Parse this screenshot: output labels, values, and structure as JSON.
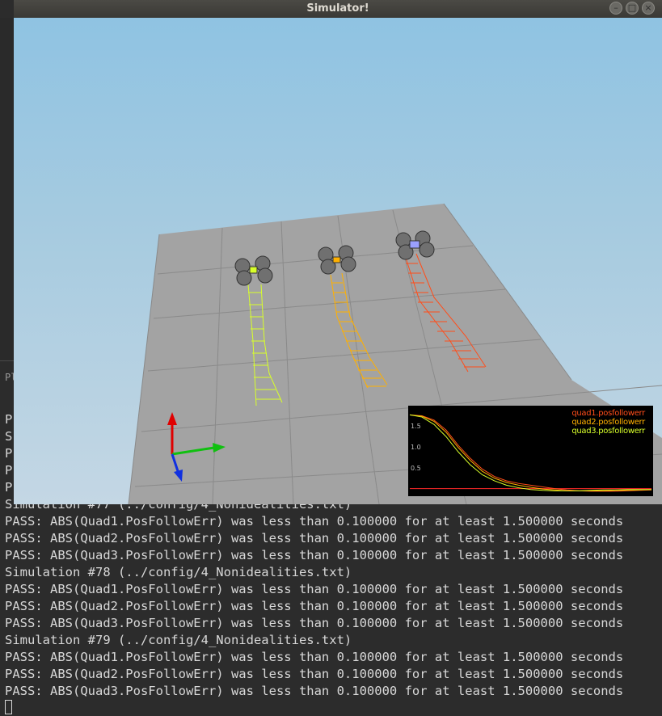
{
  "window": {
    "title": "Simulator!",
    "buttons": [
      "minimize",
      "maximize",
      "close"
    ]
  },
  "terminal": {
    "partial_lines": [
      "Pl",
      "P",
      "S",
      "P",
      "P",
      "P"
    ],
    "lines": [
      "Simulation #77 (../config/4_Nonidealities.txt)",
      "PASS: ABS(Quad1.PosFollowErr) was less than 0.100000 for at least 1.500000 seconds",
      "PASS: ABS(Quad2.PosFollowErr) was less than 0.100000 for at least 1.500000 seconds",
      "PASS: ABS(Quad3.PosFollowErr) was less than 0.100000 for at least 1.500000 seconds",
      "Simulation #78 (../config/4_Nonidealities.txt)",
      "PASS: ABS(Quad1.PosFollowErr) was less than 0.100000 for at least 1.500000 seconds",
      "PASS: ABS(Quad2.PosFollowErr) was less than 0.100000 for at least 1.500000 seconds",
      "PASS: ABS(Quad3.PosFollowErr) was less than 0.100000 for at least 1.500000 seconds",
      "Simulation #79 (../config/4_Nonidealities.txt)",
      "PASS: ABS(Quad1.PosFollowErr) was less than 0.100000 for at least 1.500000 seconds",
      "PASS: ABS(Quad2.PosFollowErr) was less than 0.100000 for at least 1.500000 seconds",
      "PASS: ABS(Quad3.PosFollowErr) was less than 0.100000 for at least 1.500000 seconds"
    ]
  },
  "colors": {
    "quad1": "#ff4d1a",
    "quad2": "#ffb000",
    "quad3": "#d8ff2a"
  },
  "chart_data": {
    "type": "line",
    "yticks": [
      "1.5",
      "1.0",
      "0.5"
    ],
    "ylim": [
      0,
      1.9
    ],
    "series": [
      {
        "name": "quad1.posfollowerr",
        "color": "#ff4d1a",
        "x": [
          0,
          0.05,
          0.1,
          0.15,
          0.2,
          0.25,
          0.3,
          0.35,
          0.4,
          0.45,
          0.5,
          0.55,
          0.6,
          0.65,
          0.7,
          0.75,
          0.8,
          0.85,
          0.9,
          0.95,
          1.0
        ],
        "values": [
          1.8,
          1.78,
          1.68,
          1.45,
          1.1,
          0.8,
          0.55,
          0.38,
          0.28,
          0.22,
          0.18,
          0.14,
          0.1,
          0.07,
          0.05,
          0.04,
          0.04,
          0.04,
          0.05,
          0.06,
          0.07
        ]
      },
      {
        "name": "quad2.posfollowerr",
        "color": "#ffb000",
        "x": [
          0,
          0.05,
          0.1,
          0.15,
          0.2,
          0.25,
          0.3,
          0.35,
          0.4,
          0.45,
          0.5,
          0.55,
          0.6,
          0.65,
          0.7,
          0.75,
          0.8,
          0.85,
          0.9,
          0.95,
          1.0
        ],
        "values": [
          1.8,
          1.77,
          1.65,
          1.4,
          1.05,
          0.75,
          0.5,
          0.34,
          0.24,
          0.18,
          0.13,
          0.09,
          0.07,
          0.05,
          0.05,
          0.05,
          0.05,
          0.06,
          0.06,
          0.07,
          0.08
        ]
      },
      {
        "name": "quad3.posfollowerr",
        "color": "#d8ff2a",
        "x": [
          0,
          0.05,
          0.1,
          0.15,
          0.2,
          0.25,
          0.3,
          0.35,
          0.4,
          0.45,
          0.5,
          0.55,
          0.6,
          0.65,
          0.7,
          0.75,
          0.8,
          0.85,
          0.9,
          0.95,
          1.0
        ],
        "values": [
          1.8,
          1.75,
          1.58,
          1.3,
          0.95,
          0.65,
          0.42,
          0.28,
          0.18,
          0.12,
          0.08,
          0.06,
          0.05,
          0.05,
          0.05,
          0.06,
          0.07,
          0.07,
          0.08,
          0.08,
          0.08
        ]
      }
    ],
    "threshold": 0.1
  }
}
